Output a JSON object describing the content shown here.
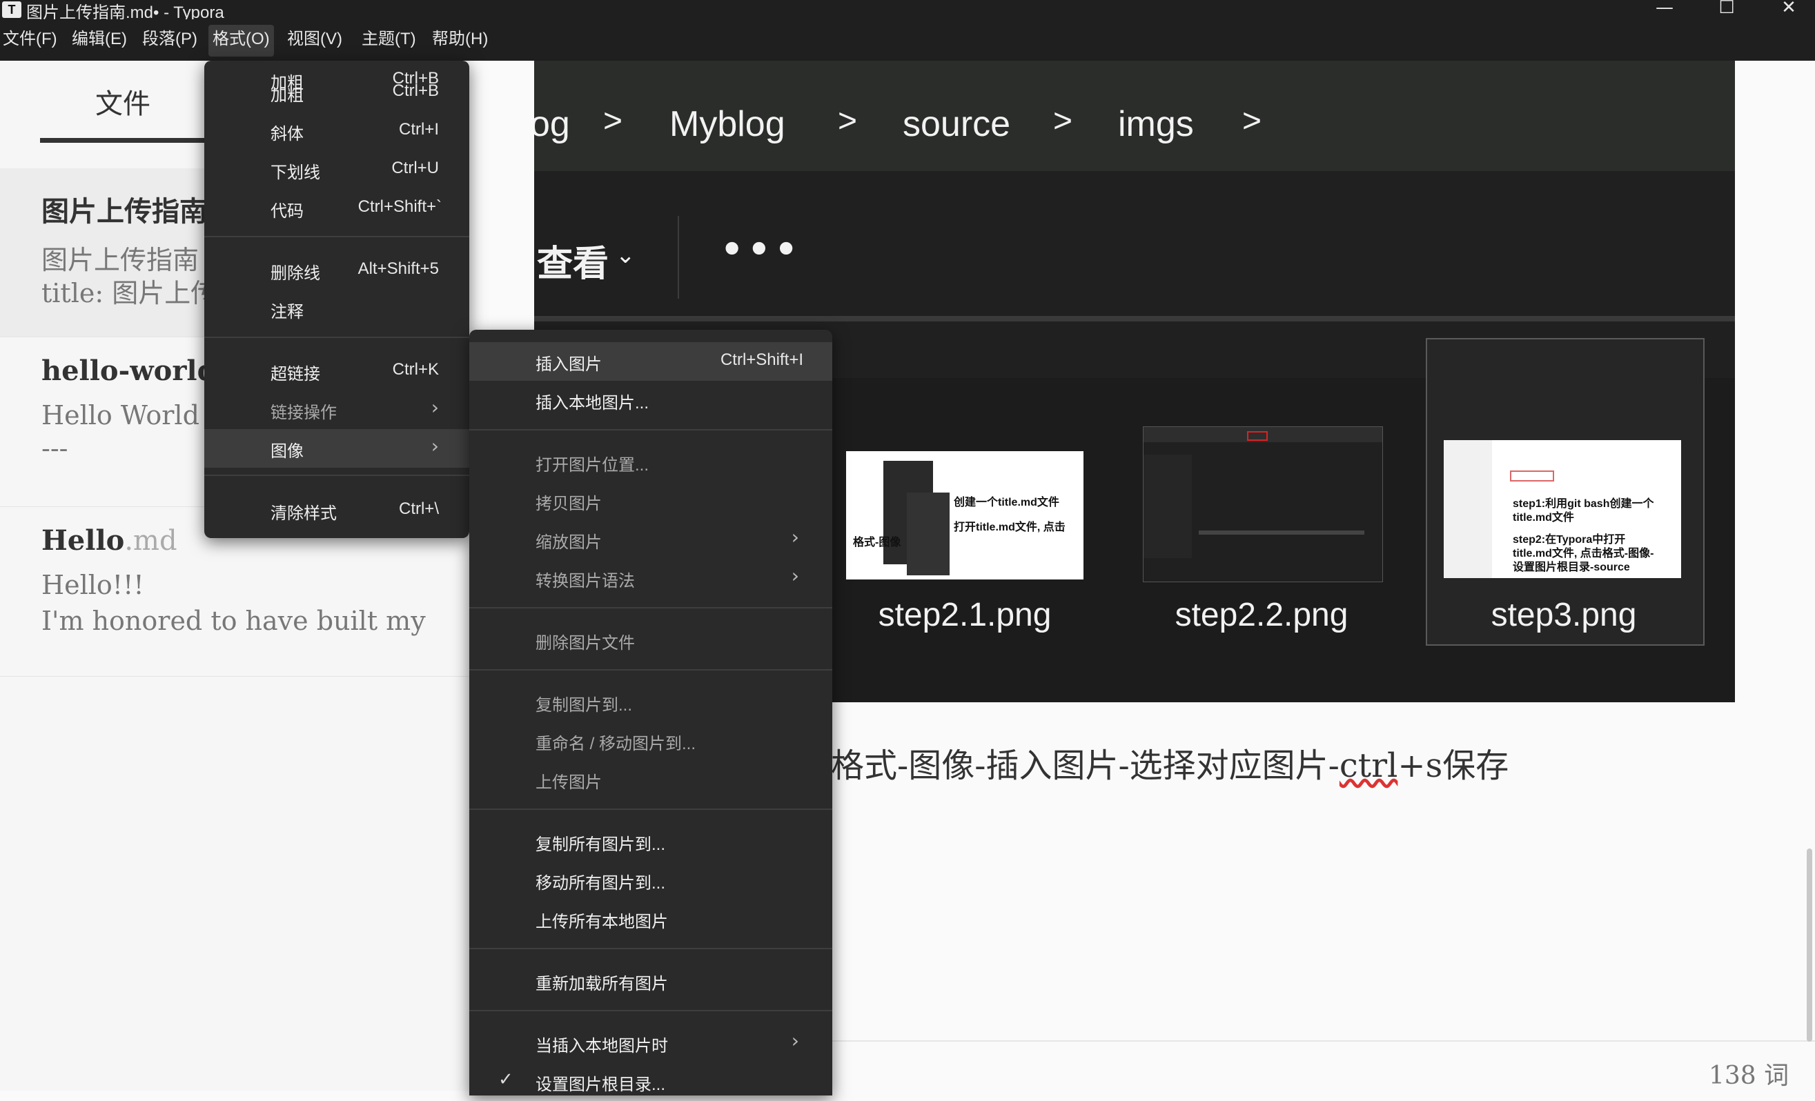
{
  "window": {
    "title": "图片上传指南.md• - Typora",
    "app_icon": "T",
    "minimize": "—",
    "maximize": "☐",
    "close": "✕"
  },
  "menubar": {
    "items": [
      {
        "label": "文件(F)"
      },
      {
        "label": "编辑(E)"
      },
      {
        "label": "段落(P)"
      },
      {
        "label": "格式(O)"
      },
      {
        "label": "视图(V)"
      },
      {
        "label": "主题(T)"
      },
      {
        "label": "帮助(H)"
      }
    ]
  },
  "sidebar": {
    "tab_label": "文件",
    "files": [
      {
        "title": "图片上传指南",
        "ext": "",
        "line1": "图片上传指南",
        "line2": "title: 图片上传"
      },
      {
        "title": "hello-world",
        "ext": "",
        "line1": "Hello World",
        "line2": "---"
      },
      {
        "title": "Hello",
        "ext": ".md",
        "line1": "Hello!!!",
        "line2": "I'm honored to have built my"
      }
    ]
  },
  "embedded_screenshot": {
    "breadcrumb": [
      "og",
      "Myblog",
      "source",
      "imgs"
    ],
    "breadcrumb_sep": ">",
    "view_label": "查看",
    "view_chevron": "⌄",
    "more": "•••",
    "thumbnails": [
      {
        "caption": "step2.1.png",
        "text1": "创建一个title.md文件",
        "text2": "打开title.md文件, 点击",
        "text3": "格式-图像"
      },
      {
        "caption": "step2.2.png"
      },
      {
        "caption": "step3.png",
        "text1": "step1:利用git bash创建一个",
        "text2": "title.md文件",
        "text3": "step2:在Typora中打开",
        "text4": "title.md文件, 点击格式-图像-",
        "text5": "设置图片根目录-source"
      }
    ]
  },
  "body": {
    "text_before": "格式-图像-插入图片-选择对应图片-",
    "text_spell": "ctrl",
    "text_after": "+s保存"
  },
  "status": {
    "word_count": "138 词"
  },
  "format_menu": {
    "items": [
      {
        "label": "加粗",
        "shortcut": "Ctrl+B"
      },
      {
        "label": "斜体",
        "shortcut": "Ctrl+I"
      },
      {
        "label": "下划线",
        "shortcut": "Ctrl+U"
      },
      {
        "label": "代码",
        "shortcut": "Ctrl+Shift+`"
      },
      {
        "label": "删除线",
        "shortcut": "Alt+Shift+5"
      },
      {
        "label": "注释",
        "shortcut": ""
      },
      {
        "label": "超链接",
        "shortcut": "Ctrl+K"
      },
      {
        "label": "链接操作",
        "shortcut": ""
      },
      {
        "label": "图像",
        "shortcut": ""
      },
      {
        "label": "清除样式",
        "shortcut": "Ctrl+\\"
      }
    ],
    "arrow": "›"
  },
  "image_submenu": {
    "items": [
      {
        "label": "插入图片",
        "shortcut": "Ctrl+Shift+I"
      },
      {
        "label": "插入本地图片..."
      },
      {
        "label": "打开图片位置..."
      },
      {
        "label": "拷贝图片"
      },
      {
        "label": "缩放图片"
      },
      {
        "label": "转换图片语法"
      },
      {
        "label": "删除图片文件"
      },
      {
        "label": "复制图片到..."
      },
      {
        "label": "重命名 / 移动图片到..."
      },
      {
        "label": "上传图片"
      },
      {
        "label": "复制所有图片到..."
      },
      {
        "label": "移动所有图片到..."
      },
      {
        "label": "上传所有本地图片"
      },
      {
        "label": "重新加载所有图片"
      },
      {
        "label": "当插入本地图片时"
      },
      {
        "label": "设置图片根目录..."
      }
    ],
    "check": "✓",
    "arrow": "›"
  }
}
